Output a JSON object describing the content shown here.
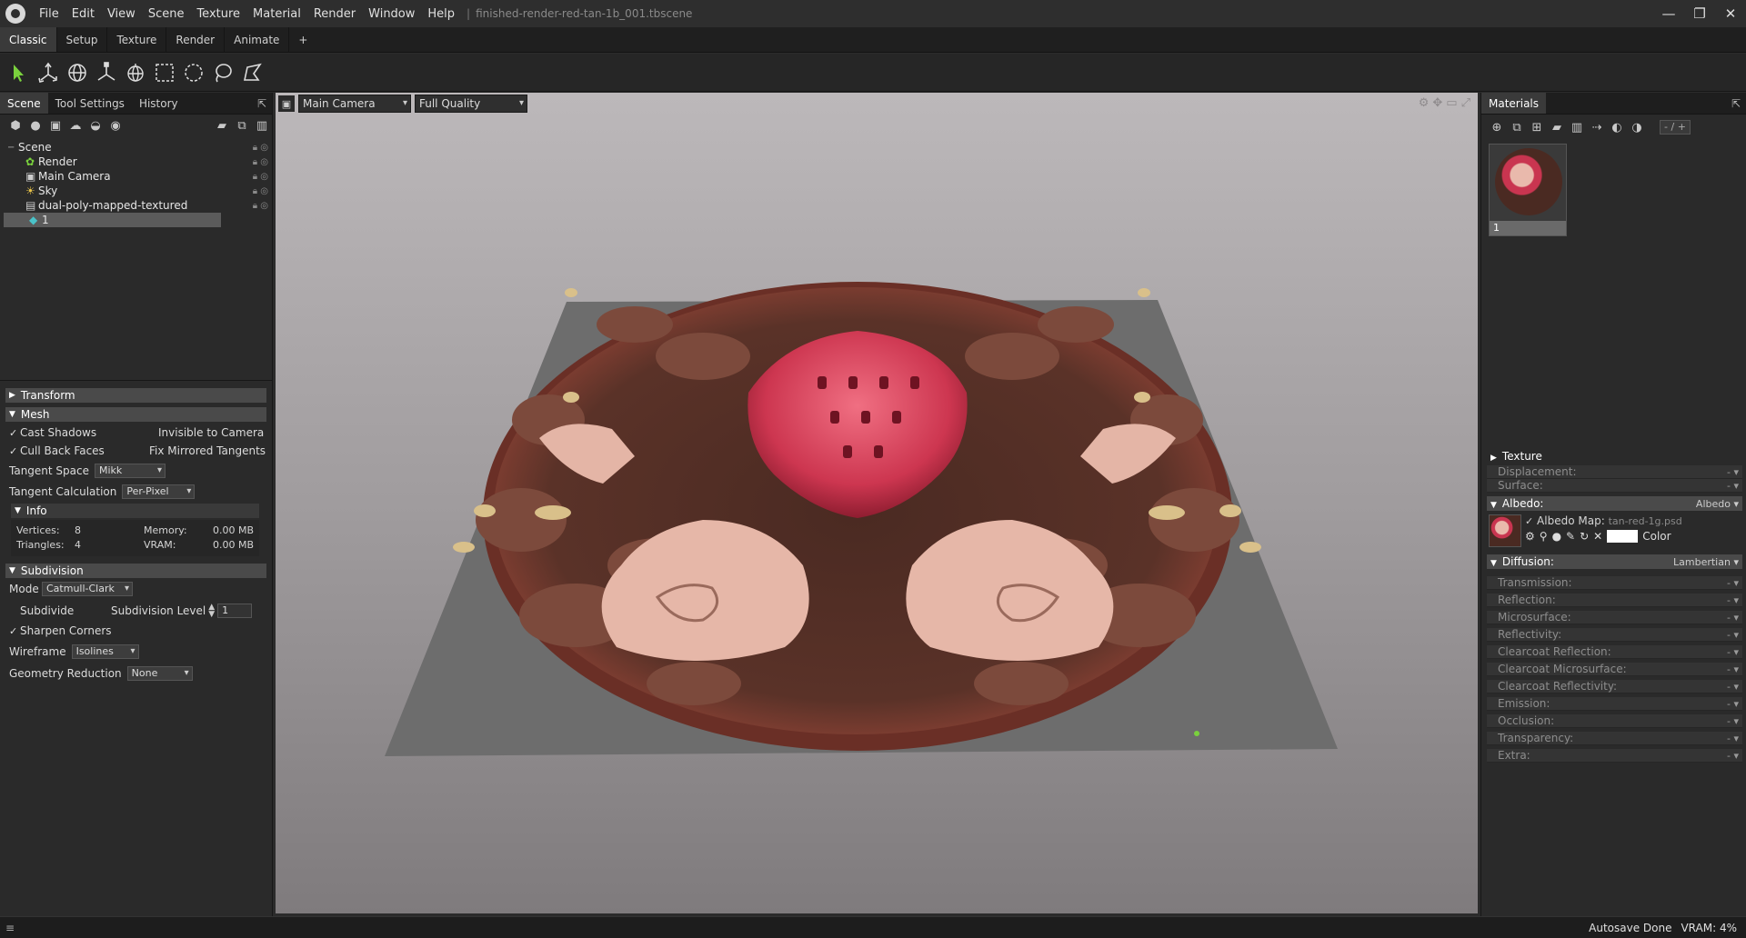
{
  "menu": {
    "items": [
      "File",
      "Edit",
      "View",
      "Scene",
      "Texture",
      "Material",
      "Render",
      "Window",
      "Help"
    ],
    "separator": "|",
    "filename": "finished-render-red-tan-1b_001.tbscene"
  },
  "window_controls": {
    "minimize": "—",
    "maximize": "❐",
    "close": "✕"
  },
  "workspace_tabs": [
    "Classic",
    "Setup",
    "Texture",
    "Render",
    "Animate",
    "+"
  ],
  "left_panel": {
    "tabs": [
      "Scene",
      "Tool Settings",
      "History"
    ],
    "tree": [
      {
        "label": "Scene"
      },
      {
        "label": "Render"
      },
      {
        "label": "Main Camera"
      },
      {
        "label": "Sky"
      },
      {
        "label": "dual-poly-mapped-textured"
      },
      {
        "label": "1"
      }
    ]
  },
  "properties": {
    "transform_label": "Transform",
    "mesh_label": "Mesh",
    "cast_shadows": "Cast Shadows",
    "invisible_to_camera": "Invisible to Camera",
    "cull_back_faces": "Cull Back Faces",
    "fix_mirrored_tangents": "Fix Mirrored Tangents",
    "tangent_space_label": "Tangent Space",
    "tangent_space_value": "Mikk",
    "tangent_calc_label": "Tangent Calculation",
    "tangent_calc_value": "Per-Pixel",
    "info_label": "Info",
    "vertices_label": "Vertices:",
    "vertices_value": "8",
    "memory_label": "Memory:",
    "memory_value": "0.00 MB",
    "triangles_label": "Triangles:",
    "triangles_value": "4",
    "vram_label": "VRAM:",
    "vram_value": "0.00 MB",
    "subdivision_label": "Subdivision",
    "mode_label": "Mode",
    "mode_value": "Catmull-Clark",
    "subdivide_label": "Subdivide",
    "subdivision_level_label": "Subdivision Level",
    "subdivision_level_value": "1",
    "sharpen_corners": "Sharpen Corners",
    "wireframe_label": "Wireframe",
    "wireframe_value": "Isolines",
    "geometry_reduction_label": "Geometry Reduction",
    "geometry_reduction_value": "None"
  },
  "viewport": {
    "camera": "Main Camera",
    "quality": "Full Quality"
  },
  "materials": {
    "title": "Materials",
    "counter": "- / +",
    "thumb_label": "1",
    "texture_label": "Texture",
    "rows_top": [
      {
        "label": "Displacement:",
        "value": "-"
      },
      {
        "label": "Surface:",
        "value": "-"
      }
    ],
    "albedo_label": "Albedo:",
    "albedo_value": "Albedo",
    "albedo_map_label": "Albedo Map:",
    "albedo_map_file": "tan-red-1g.psd",
    "color_label": "Color",
    "diffusion_label": "Diffusion:",
    "diffusion_value": "Lambertian",
    "rows_bottom": [
      {
        "label": "Transmission:",
        "value": "-"
      },
      {
        "label": "Reflection:",
        "value": "-"
      },
      {
        "label": "Microsurface:",
        "value": "-"
      },
      {
        "label": "Reflectivity:",
        "value": "-"
      },
      {
        "label": "Clearcoat Reflection:",
        "value": "-"
      },
      {
        "label": "Clearcoat Microsurface:",
        "value": "-"
      },
      {
        "label": "Clearcoat Reflectivity:",
        "value": "-"
      },
      {
        "label": "Emission:",
        "value": "-"
      },
      {
        "label": "Occlusion:",
        "value": "-"
      },
      {
        "label": "Transparency:",
        "value": "-"
      },
      {
        "label": "Extra:",
        "value": "-"
      }
    ]
  },
  "status": {
    "autosave": "Autosave Done",
    "vram": "VRAM: 4%"
  },
  "colors": {
    "accent_green": "#7ad13d",
    "viewport_top": "#bab6b8",
    "viewport_bottom": "#7e7b7d",
    "plane": "#6d6d6d",
    "disc_dark": "#3a201b",
    "disc_mid": "#6a3a2e",
    "berry": "#c9324b",
    "cream": "#e6b3a5"
  }
}
